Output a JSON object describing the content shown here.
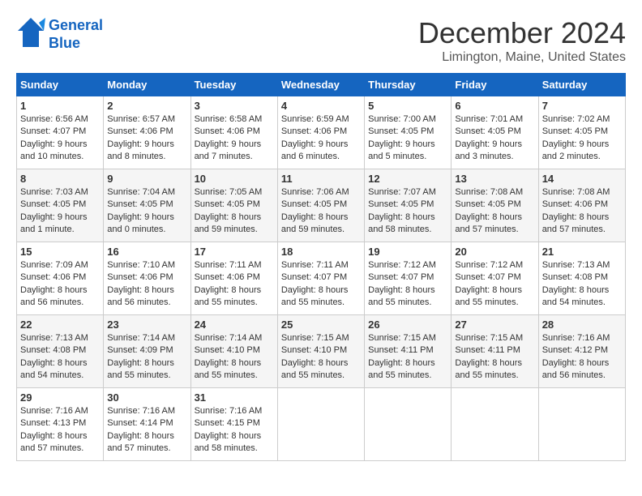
{
  "header": {
    "logo_line1": "General",
    "logo_line2": "Blue",
    "title": "December 2024",
    "location": "Limington, Maine, United States"
  },
  "weekdays": [
    "Sunday",
    "Monday",
    "Tuesday",
    "Wednesday",
    "Thursday",
    "Friday",
    "Saturday"
  ],
  "weeks": [
    [
      {
        "day": "1",
        "sunrise": "Sunrise: 6:56 AM",
        "sunset": "Sunset: 4:07 PM",
        "daylight": "Daylight: 9 hours and 10 minutes."
      },
      {
        "day": "2",
        "sunrise": "Sunrise: 6:57 AM",
        "sunset": "Sunset: 4:06 PM",
        "daylight": "Daylight: 9 hours and 8 minutes."
      },
      {
        "day": "3",
        "sunrise": "Sunrise: 6:58 AM",
        "sunset": "Sunset: 4:06 PM",
        "daylight": "Daylight: 9 hours and 7 minutes."
      },
      {
        "day": "4",
        "sunrise": "Sunrise: 6:59 AM",
        "sunset": "Sunset: 4:06 PM",
        "daylight": "Daylight: 9 hours and 6 minutes."
      },
      {
        "day": "5",
        "sunrise": "Sunrise: 7:00 AM",
        "sunset": "Sunset: 4:05 PM",
        "daylight": "Daylight: 9 hours and 5 minutes."
      },
      {
        "day": "6",
        "sunrise": "Sunrise: 7:01 AM",
        "sunset": "Sunset: 4:05 PM",
        "daylight": "Daylight: 9 hours and 3 minutes."
      },
      {
        "day": "7",
        "sunrise": "Sunrise: 7:02 AM",
        "sunset": "Sunset: 4:05 PM",
        "daylight": "Daylight: 9 hours and 2 minutes."
      }
    ],
    [
      {
        "day": "8",
        "sunrise": "Sunrise: 7:03 AM",
        "sunset": "Sunset: 4:05 PM",
        "daylight": "Daylight: 9 hours and 1 minute."
      },
      {
        "day": "9",
        "sunrise": "Sunrise: 7:04 AM",
        "sunset": "Sunset: 4:05 PM",
        "daylight": "Daylight: 9 hours and 0 minutes."
      },
      {
        "day": "10",
        "sunrise": "Sunrise: 7:05 AM",
        "sunset": "Sunset: 4:05 PM",
        "daylight": "Daylight: 8 hours and 59 minutes."
      },
      {
        "day": "11",
        "sunrise": "Sunrise: 7:06 AM",
        "sunset": "Sunset: 4:05 PM",
        "daylight": "Daylight: 8 hours and 59 minutes."
      },
      {
        "day": "12",
        "sunrise": "Sunrise: 7:07 AM",
        "sunset": "Sunset: 4:05 PM",
        "daylight": "Daylight: 8 hours and 58 minutes."
      },
      {
        "day": "13",
        "sunrise": "Sunrise: 7:08 AM",
        "sunset": "Sunset: 4:05 PM",
        "daylight": "Daylight: 8 hours and 57 minutes."
      },
      {
        "day": "14",
        "sunrise": "Sunrise: 7:08 AM",
        "sunset": "Sunset: 4:06 PM",
        "daylight": "Daylight: 8 hours and 57 minutes."
      }
    ],
    [
      {
        "day": "15",
        "sunrise": "Sunrise: 7:09 AM",
        "sunset": "Sunset: 4:06 PM",
        "daylight": "Daylight: 8 hours and 56 minutes."
      },
      {
        "day": "16",
        "sunrise": "Sunrise: 7:10 AM",
        "sunset": "Sunset: 4:06 PM",
        "daylight": "Daylight: 8 hours and 56 minutes."
      },
      {
        "day": "17",
        "sunrise": "Sunrise: 7:11 AM",
        "sunset": "Sunset: 4:06 PM",
        "daylight": "Daylight: 8 hours and 55 minutes."
      },
      {
        "day": "18",
        "sunrise": "Sunrise: 7:11 AM",
        "sunset": "Sunset: 4:07 PM",
        "daylight": "Daylight: 8 hours and 55 minutes."
      },
      {
        "day": "19",
        "sunrise": "Sunrise: 7:12 AM",
        "sunset": "Sunset: 4:07 PM",
        "daylight": "Daylight: 8 hours and 55 minutes."
      },
      {
        "day": "20",
        "sunrise": "Sunrise: 7:12 AM",
        "sunset": "Sunset: 4:07 PM",
        "daylight": "Daylight: 8 hours and 55 minutes."
      },
      {
        "day": "21",
        "sunrise": "Sunrise: 7:13 AM",
        "sunset": "Sunset: 4:08 PM",
        "daylight": "Daylight: 8 hours and 54 minutes."
      }
    ],
    [
      {
        "day": "22",
        "sunrise": "Sunrise: 7:13 AM",
        "sunset": "Sunset: 4:08 PM",
        "daylight": "Daylight: 8 hours and 54 minutes."
      },
      {
        "day": "23",
        "sunrise": "Sunrise: 7:14 AM",
        "sunset": "Sunset: 4:09 PM",
        "daylight": "Daylight: 8 hours and 55 minutes."
      },
      {
        "day": "24",
        "sunrise": "Sunrise: 7:14 AM",
        "sunset": "Sunset: 4:10 PM",
        "daylight": "Daylight: 8 hours and 55 minutes."
      },
      {
        "day": "25",
        "sunrise": "Sunrise: 7:15 AM",
        "sunset": "Sunset: 4:10 PM",
        "daylight": "Daylight: 8 hours and 55 minutes."
      },
      {
        "day": "26",
        "sunrise": "Sunrise: 7:15 AM",
        "sunset": "Sunset: 4:11 PM",
        "daylight": "Daylight: 8 hours and 55 minutes."
      },
      {
        "day": "27",
        "sunrise": "Sunrise: 7:15 AM",
        "sunset": "Sunset: 4:11 PM",
        "daylight": "Daylight: 8 hours and 55 minutes."
      },
      {
        "day": "28",
        "sunrise": "Sunrise: 7:16 AM",
        "sunset": "Sunset: 4:12 PM",
        "daylight": "Daylight: 8 hours and 56 minutes."
      }
    ],
    [
      {
        "day": "29",
        "sunrise": "Sunrise: 7:16 AM",
        "sunset": "Sunset: 4:13 PM",
        "daylight": "Daylight: 8 hours and 57 minutes."
      },
      {
        "day": "30",
        "sunrise": "Sunrise: 7:16 AM",
        "sunset": "Sunset: 4:14 PM",
        "daylight": "Daylight: 8 hours and 57 minutes."
      },
      {
        "day": "31",
        "sunrise": "Sunrise: 7:16 AM",
        "sunset": "Sunset: 4:15 PM",
        "daylight": "Daylight: 8 hours and 58 minutes."
      },
      null,
      null,
      null,
      null
    ]
  ]
}
